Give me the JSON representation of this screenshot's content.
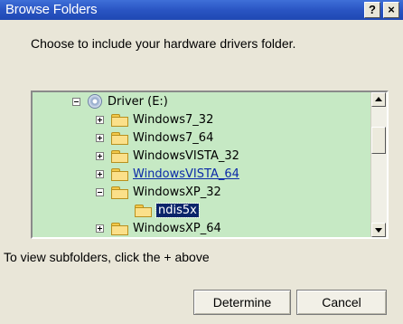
{
  "window": {
    "title": "Browse Folders",
    "help_label": "?",
    "close_label": "×"
  },
  "prompt": "Choose to include your hardware drivers folder.",
  "tree": {
    "root": {
      "label": "Driver (E:)",
      "icon": "cd-drive-icon",
      "expanded": true
    },
    "items": [
      {
        "label": "Windows7_32",
        "expander": "plus",
        "icon": "folder-icon"
      },
      {
        "label": "Windows7_64",
        "expander": "plus",
        "icon": "folder-icon"
      },
      {
        "label": "WindowsVISTA_32",
        "expander": "plus",
        "icon": "folder-icon"
      },
      {
        "label": "WindowsVISTA_64",
        "expander": "plus",
        "icon": "folder-icon",
        "hovered": true
      },
      {
        "label": "WindowsXP_32",
        "expander": "minus",
        "icon": "folder-icon"
      },
      {
        "label": "ndis5x",
        "icon": "open-folder-icon",
        "selected": true
      },
      {
        "label": "WindowsXP_64",
        "expander": "plus",
        "icon": "folder-icon"
      }
    ]
  },
  "hint": "To view subfolders, click the + above",
  "buttons": {
    "ok": "Determine",
    "cancel": "Cancel"
  },
  "colors": {
    "title_bar": "#2a55c3",
    "tree_background": "#c6e9c4",
    "selection": "#0a246a",
    "dialog_background": "#e9e6d8"
  }
}
